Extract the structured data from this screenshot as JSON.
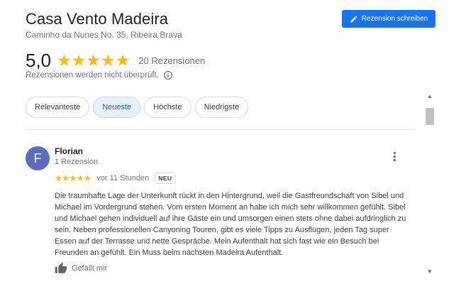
{
  "place": {
    "name": "Casa Vento Madeira",
    "address": "Caminho da Nunes No. 35, Ribeira Brava"
  },
  "actions": {
    "write_review": "Rezension schreiben"
  },
  "summary": {
    "rating": "5,0",
    "stars": 5,
    "review_count": "20 Rezensionen",
    "unchecked_note": "Rezensionen werden nicht überprüft.",
    "info_glyph": "i"
  },
  "filters": {
    "relevant": "Relevanteste",
    "newest": "Neueste",
    "highest": "Höchste",
    "lowest": "Niedrigste",
    "active": "Neueste"
  },
  "review": {
    "avatar_letter": "F",
    "avatar_color": "#5c6bc0",
    "author": "Florian",
    "author_meta": "1 Rezension",
    "stars": "★★★★★",
    "time": "vor 11 Stunden",
    "badge": "NEU",
    "text": "Die traumhafte Lage der Unterkunft rückt in den Hintergrund, weil die Gastfreundschaft von Sibel und Michael im Vordergrund stehen. Vom ersten Moment an habe ich mich sehr willkommen gefühlt. Sibel und Michael gehen individuell auf ihre Gäste ein und umsorgen einen stets ohne dabei aufdringlich zu sein. Neben professionellen Canyoning Touren, gibt es viele Tipps zu Ausflügen, jeden Tag super Essen auf der Terrasse und nette Gespräche. Mein Aufenthalt hat sich fast wie ein Besuch bei Freunden an gefühlt. Ein Muss beim nächsten Madeira Aufenthalt.",
    "like_label": "Gefällt mir"
  },
  "colors": {
    "accent": "#1a73e8",
    "star": "#fbbc04"
  }
}
